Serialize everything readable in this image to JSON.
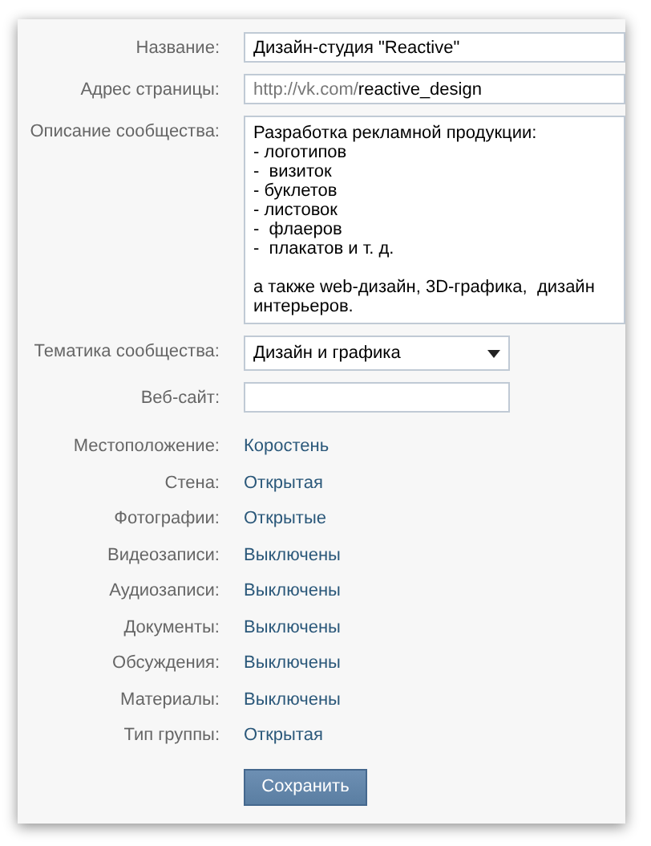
{
  "fields": [
    {
      "kind": "text",
      "label": "Название:",
      "value": "Дизайн-студия \"Reactive\""
    },
    {
      "kind": "address",
      "label": "Адрес страницы:",
      "prefix": "http://vk.com/",
      "value": "reactive_design"
    },
    {
      "kind": "textarea",
      "label": "Описание сообщества:",
      "value": "Разработка рекламной продукции:\n- логотипов\n-  визиток\n- буклетов\n- листовок\n-  флаеров\n-  плакатов и т. д.\n\nа также web-дизайн, 3D-графика,  дизайн интерьеров."
    },
    {
      "kind": "select",
      "label": "Тематика сообщества:",
      "value": "Дизайн и графика"
    },
    {
      "kind": "text",
      "label": "Веб-сайт:"
    }
  ],
  "settings": [
    {
      "label": "Местоположение:",
      "value": "Коростень"
    },
    {
      "label": "Стена:",
      "value": "Открытая"
    },
    {
      "label": "Фотографии:",
      "value": "Открытые"
    },
    {
      "label": "Видеозаписи:",
      "value": "Выключены"
    },
    {
      "label": "Аудиозаписи:",
      "value": "Выключены"
    },
    {
      "label": "Документы:",
      "value": "Выключены"
    },
    {
      "label": "Обсуждения:",
      "value": "Выключены"
    },
    {
      "label": "Материалы:",
      "value": "Выключены"
    },
    {
      "label": "Тип группы:",
      "value": "Открытая"
    }
  ],
  "save_button": "Сохранить"
}
